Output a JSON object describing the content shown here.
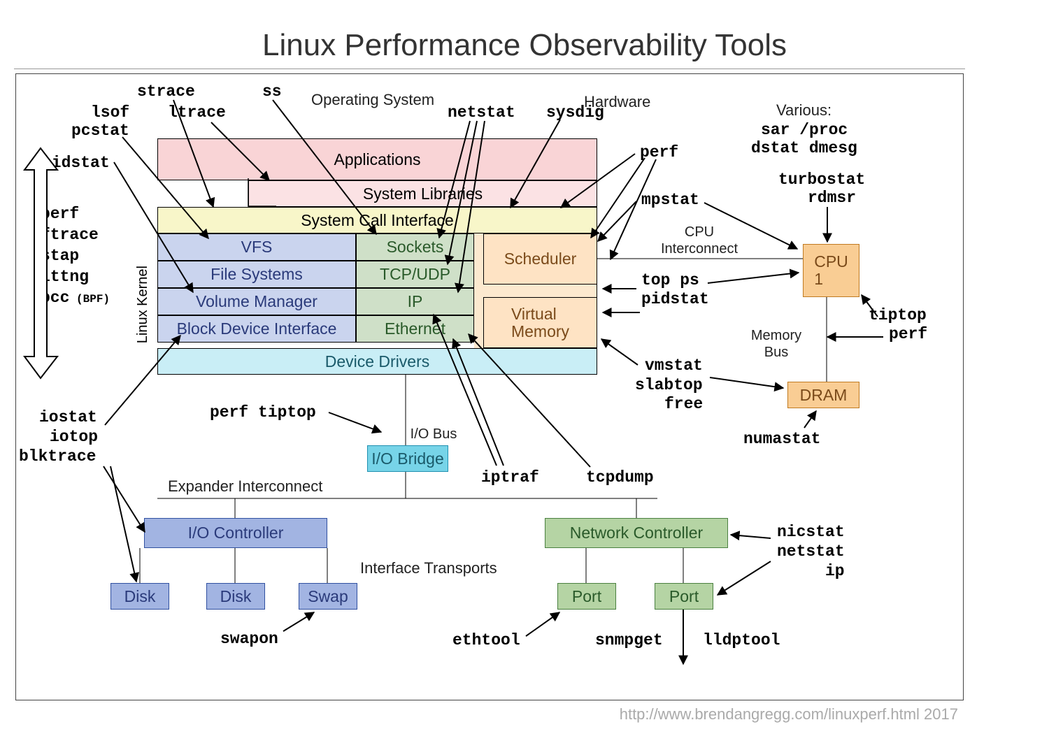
{
  "title": "Linux Performance Observability Tools",
  "footer": "http://www.brendangregg.com/linuxperf.html 2017",
  "sections": {
    "os": "Operating System",
    "hw": "Hardware",
    "various": "Various:",
    "kernel": "Linux Kernel",
    "cpu_ic": "CPU Interconnect",
    "mem_bus": "Memory Bus",
    "io_bus": "I/O Bus",
    "exp_ic": "Expander Interconnect",
    "if_tr": "Interface Transports"
  },
  "boxes": {
    "apps": "Applications",
    "syslib": "System Libraries",
    "sci": "System Call Interface",
    "vfs": "VFS",
    "sockets": "Sockets",
    "scheduler": "Scheduler",
    "fs": "File Systems",
    "tcpudp": "TCP/UDP",
    "vm": "Volume Manager",
    "ip": "IP",
    "virtmem": "Virtual Memory",
    "bdi": "Block Device Interface",
    "eth": "Ethernet",
    "dd": "Device Drivers",
    "iobridge": "I/O Bridge",
    "ioctrl": "I/O Controller",
    "netctrl": "Network Controller",
    "disk1": "Disk",
    "disk2": "Disk",
    "swap": "Swap",
    "port1": "Port",
    "port2": "Port",
    "cpu1a": "CPU",
    "cpu1b": "1",
    "dram": "DRAM"
  },
  "tools": {
    "strace": "strace",
    "ss": "ss",
    "lsof": "lsof",
    "pcstat": "pcstat",
    "ltrace": "ltrace",
    "pidstat": "pidstat",
    "netstat": "netstat",
    "sysdig": "sysdig",
    "perf": "perf",
    "perf_ftrace_etc": "perf\nftrace\nstap\nlttng\nbcc",
    "bpf_suffix": "(BPF)",
    "sar_proc": "sar /proc",
    "dstat_dmesg": "dstat dmesg",
    "turbostat": "turbostat",
    "rdmsr": "rdmsr",
    "mpstat": "mpstat",
    "top_ps": "top ps",
    "pidstat2": "pidstat",
    "tiptop": "tiptop",
    "perf2": "perf",
    "vmstat": "vmstat",
    "slabtop": "slabtop",
    "free": "free",
    "numastat": "numastat",
    "perf_tiptop": "perf tiptop",
    "iostat": "iostat",
    "iotop": "iotop",
    "blktrace": "blktrace",
    "iptraf": "iptraf",
    "tcpdump": "tcpdump",
    "nicstat": "nicstat",
    "netstat2": "netstat",
    "ip_t": "ip",
    "swapon": "swapon",
    "ethtool": "ethtool",
    "snmpget": "snmpget",
    "lldptool": "lldptool"
  }
}
